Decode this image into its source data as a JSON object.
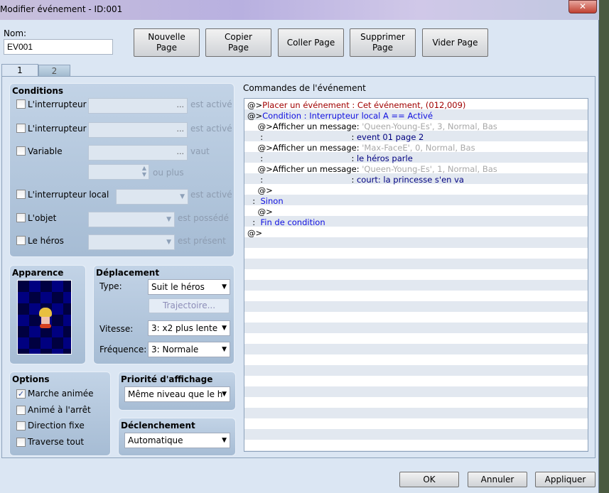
{
  "window": {
    "title": "Modifier événement - ID:001",
    "close": "✕"
  },
  "name": {
    "label": "Nom:",
    "value": "EV001"
  },
  "toolbar": [
    "Nouvelle Page",
    "Copier Page",
    "Coller Page",
    "Supprimer Page",
    "Vider Page"
  ],
  "tabs": [
    "1",
    "2"
  ],
  "conditions": {
    "title": "Conditions",
    "switch1": "L'interrupteur",
    "switch2": "L'interrupteur",
    "variable": "Variable",
    "local": "L'interrupteur local",
    "item": "L'objet",
    "hero": "Le héros",
    "est_active": "est activé",
    "vaut": "vaut",
    "ou_plus": "ou plus",
    "est_possede": "est possédé",
    "est_present": "est présent",
    "ellipsis": "..."
  },
  "appearance": {
    "title": "Apparence"
  },
  "movement": {
    "title": "Déplacement",
    "type_label": "Type:",
    "type": "Suit le héros",
    "route": "Trajectoire...",
    "speed_label": "Vitesse:",
    "speed": "3: x2 plus lente",
    "freq_label": "Fréquence:",
    "freq": "3: Normale"
  },
  "options": {
    "title": "Options",
    "items": [
      {
        "label": "Marche animée",
        "checked": true
      },
      {
        "label": "Animé à l'arrêt",
        "checked": false
      },
      {
        "label": "Direction fixe",
        "checked": false
      },
      {
        "label": "Traverse tout",
        "checked": false
      }
    ]
  },
  "priority": {
    "title": "Priorité d'affichage",
    "value": "Même niveau que le h"
  },
  "trigger": {
    "title": "Déclenchement",
    "value": "Automatique"
  },
  "commands": {
    "title": "Commandes de l'événement",
    "rows": [
      [
        {
          "t": "@>",
          "c": ""
        },
        {
          "t": "Placer un événement : Cet événement, (012,009)",
          "c": "red"
        }
      ],
      [
        {
          "t": "@>",
          "c": ""
        },
        {
          "t": "Condition : Interrupteur local A == Activé",
          "c": "blue"
        }
      ],
      [
        {
          "t": "    @>Afficher un message: ",
          "c": ""
        },
        {
          "t": "'Queen-Young-Es', 3, Normal, Bas",
          "c": "gray"
        }
      ],
      [
        {
          "t": "     :                                  : ",
          "c": ""
        },
        {
          "t": "event 01 page 2",
          "c": "navy"
        }
      ],
      [
        {
          "t": "    @>Afficher un message: ",
          "c": ""
        },
        {
          "t": "'Max-FaceE', 0, Normal, Bas",
          "c": "gray"
        }
      ],
      [
        {
          "t": "     :                                  : ",
          "c": ""
        },
        {
          "t": "le héros parle",
          "c": "navy"
        }
      ],
      [
        {
          "t": "    @>Afficher un message: ",
          "c": ""
        },
        {
          "t": "'Queen-Young-Es', 1, Normal, Bas",
          "c": "gray"
        }
      ],
      [
        {
          "t": "     :                                  : ",
          "c": ""
        },
        {
          "t": "court: la princesse s'en va",
          "c": "navy"
        }
      ],
      [
        {
          "t": "    @>",
          "c": ""
        }
      ],
      [
        {
          "t": "  :  ",
          "c": ""
        },
        {
          "t": "Sinon",
          "c": "blue"
        }
      ],
      [
        {
          "t": "    @>",
          "c": ""
        }
      ],
      [
        {
          "t": "  :  ",
          "c": ""
        },
        {
          "t": "Fin de condition",
          "c": "blue"
        }
      ],
      [
        {
          "t": "@>",
          "c": ""
        }
      ]
    ]
  },
  "footer": {
    "ok": "OK",
    "cancel": "Annuler",
    "apply": "Appliquer"
  }
}
